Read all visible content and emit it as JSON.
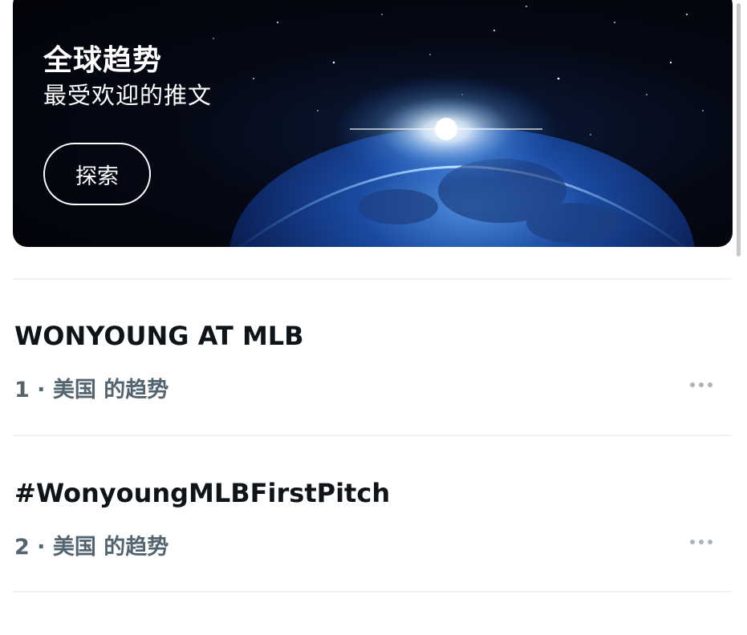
{
  "banner": {
    "title": "全球趋势",
    "subtitle": "最受欢迎的推文",
    "explore_label": "探索",
    "image": "earth-from-space-sunrise"
  },
  "trends": [
    {
      "title": "WONYOUNG AT MLB",
      "meta": "1 · 美国 的趋势",
      "more_icon": "more-horizontal-icon"
    },
    {
      "title": "#WonyoungMLBFirstPitch",
      "meta": "2 · 美国 的趋势",
      "more_icon": "more-horizontal-icon"
    }
  ],
  "colors": {
    "title_text": "#0f1419",
    "meta_text": "#536471",
    "divider": "#eff1f3",
    "banner_bg": "#050915"
  }
}
